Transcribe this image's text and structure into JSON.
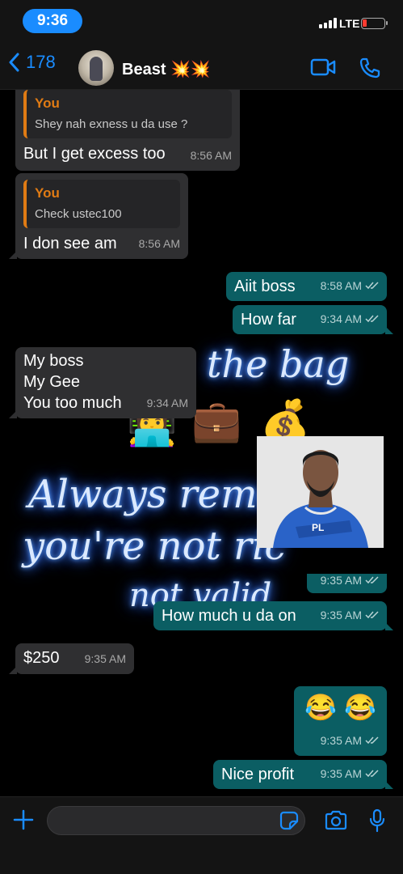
{
  "status": {
    "time": "9:36",
    "network": "LTE"
  },
  "header": {
    "back_count": "178",
    "name": "Beast 💥💥"
  },
  "wallpaper": {
    "line1": "the bag",
    "line2": "Always remem",
    "line3": "you're not ric",
    "line4": "not valid",
    "emoji": [
      "👩‍💻",
      "💼",
      "💰"
    ]
  },
  "messages": [
    {
      "quote_name": "You",
      "quote_text": "Shey nah exness u da use ?",
      "text": "But I get excess too",
      "time": "8:56 AM"
    },
    {
      "quote_name": "You",
      "quote_text": "Check ustec100",
      "text": "I don see am",
      "time": "8:56 AM"
    },
    {
      "text": "Aiit boss",
      "time": "8:58 AM"
    },
    {
      "text": "How far",
      "time": "9:34 AM"
    },
    {
      "lines": [
        "My boss",
        "My Gee",
        "You too much"
      ],
      "time": "9:34 AM"
    },
    {
      "time": "9:35 AM"
    },
    {
      "text": "How much u da on",
      "time": "9:35 AM"
    },
    {
      "text": "$250",
      "time": "9:35 AM"
    },
    {
      "text": "😂 😂",
      "time": "9:35 AM"
    },
    {
      "text": "Nice profit",
      "time": "9:35 AM"
    }
  ],
  "photo": {
    "label": "PL"
  },
  "colors": {
    "accent": "#1a8cff",
    "incoming": "#2f2f31",
    "outgoing": "#0b5e63",
    "quote_bar": "#e07b14"
  }
}
